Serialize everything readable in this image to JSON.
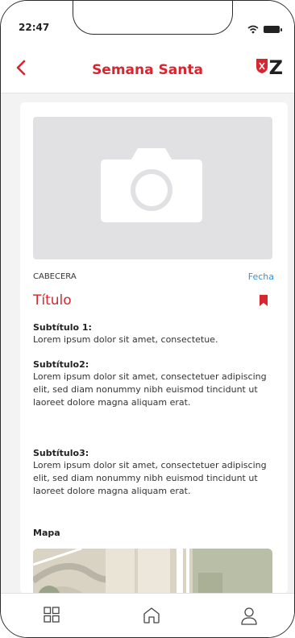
{
  "status_bar": {
    "time": "22:47"
  },
  "header": {
    "title": "Semana Santa",
    "logo_text": "Z"
  },
  "article": {
    "cabecera": "CABECERA",
    "fecha": "Fecha",
    "titulo": "Título",
    "sections": [
      {
        "subtitle": "Subtítulo 1:",
        "body": "Lorem ipsum dolor sit amet, consectetue."
      },
      {
        "subtitle": "Subtítulo2:",
        "body": "Lorem ipsum dolor sit amet, consectetuer adipiscing elit, sed diam nonummy nibh euismod tincidunt ut laoreet dolore magna aliquam erat."
      },
      {
        "subtitle": "Subtítulo3:",
        "body": "Lorem ipsum dolor sit amet, consectetuer adipiscing elit, sed diam nonummy nibh euismod tincidunt ut laoreet dolore magna aliquam erat."
      }
    ],
    "mapa_label": "Mapa"
  },
  "bottom_nav": {
    "items": [
      "grid-icon",
      "home-icon",
      "user-icon"
    ]
  },
  "colors": {
    "accent": "#d7262f",
    "link": "#3a8fd6",
    "placeholder": "#e1e1e4"
  }
}
